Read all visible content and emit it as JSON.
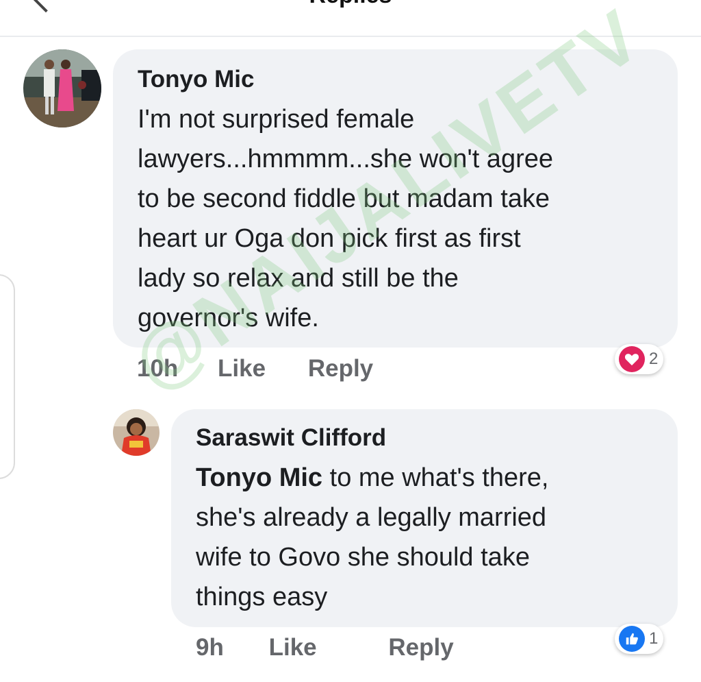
{
  "header": {
    "title": "Replies"
  },
  "comments": [
    {
      "author": "Tonyo Mic",
      "lines": [
        "I'm not surprised female",
        "lawyers...hmmmm...she won't agree",
        "to be second fiddle but madam take",
        "heart ur Oga don pick first as first",
        "lady so relax and still be the",
        "governor's wife."
      ],
      "time": "10h",
      "like_label": "Like",
      "reply_label": "Reply",
      "reaction": {
        "type": "love",
        "icon": "heart-icon",
        "count": "2",
        "color": "#e0245e"
      }
    },
    {
      "author": "Saraswit Clifford",
      "mention": "Tonyo Mic",
      "lines": [
        " to me what's there,",
        "she's already a legally married",
        "wife to Govo she should take",
        "things easy"
      ],
      "time": "9h",
      "like_label": "Like",
      "reply_label": "Reply",
      "reaction": {
        "type": "like",
        "icon": "thumbs-up-icon",
        "count": "1",
        "color": "#1877f2"
      }
    }
  ],
  "watermark": "@NAIJALIVETV"
}
